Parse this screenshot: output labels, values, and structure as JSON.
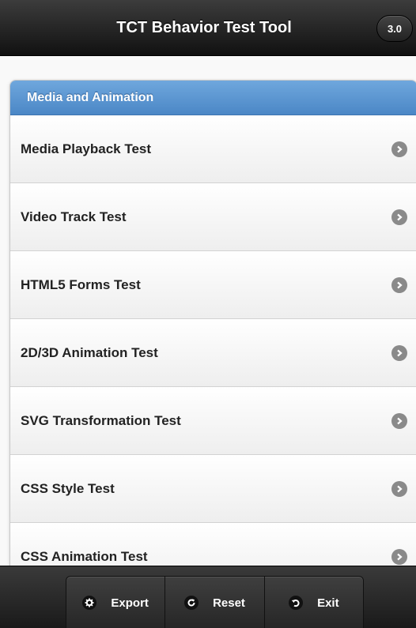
{
  "header": {
    "title": "TCT Behavior Test Tool",
    "version": "3.0"
  },
  "list": {
    "divider": "Media and Animation",
    "items": [
      {
        "label": "Media Playback Test"
      },
      {
        "label": "Video Track Test"
      },
      {
        "label": "HTML5 Forms Test"
      },
      {
        "label": "2D/3D Animation Test"
      },
      {
        "label": "SVG Transformation Test"
      },
      {
        "label": "CSS Style Test"
      },
      {
        "label": "CSS Animation Test"
      }
    ]
  },
  "footer": {
    "buttons": [
      {
        "label": "Export",
        "icon": "gear-icon"
      },
      {
        "label": "Reset",
        "icon": "refresh-icon"
      },
      {
        "label": "Exit",
        "icon": "back-icon"
      }
    ]
  },
  "colors": {
    "accent": "#4b87c6",
    "header": "#1a1a1a"
  }
}
